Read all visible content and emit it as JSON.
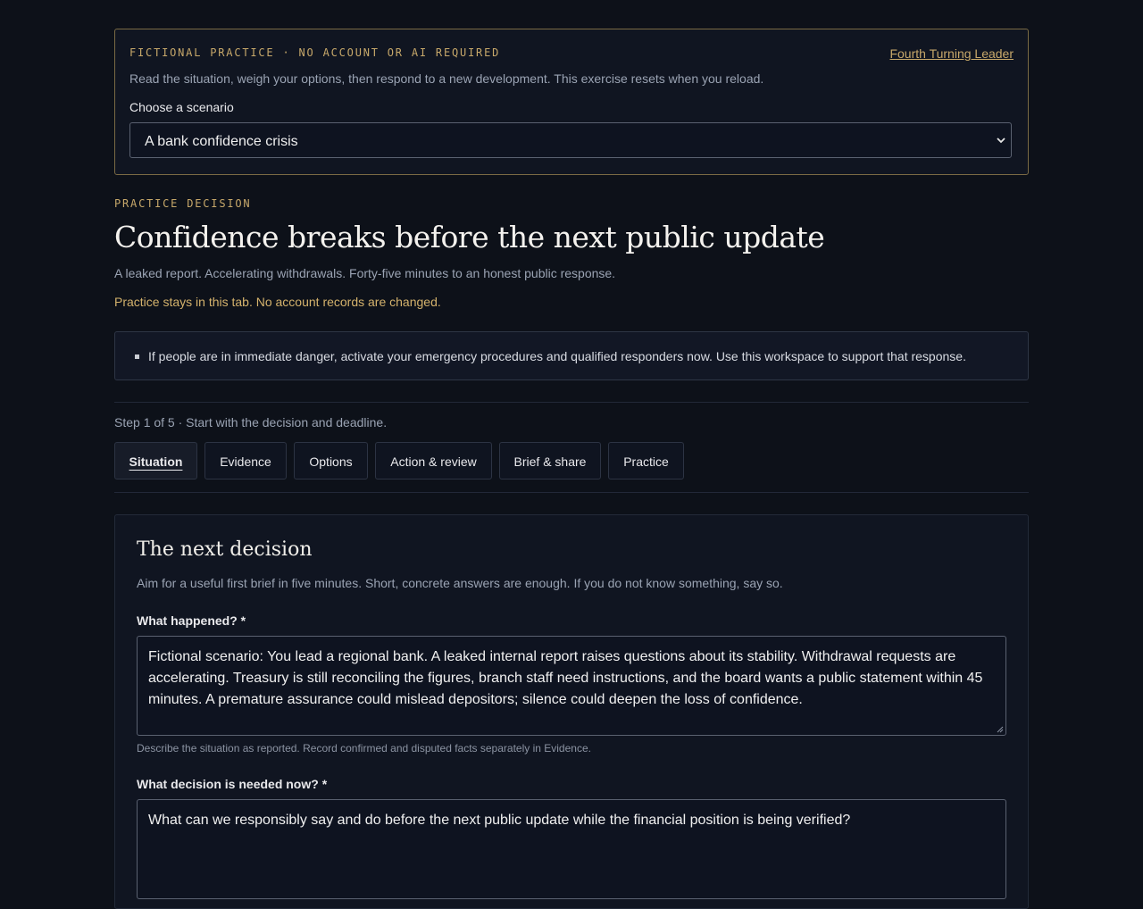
{
  "banner": {
    "tag": "FICTIONAL PRACTICE · NO ACCOUNT OR AI REQUIRED",
    "link": "Fourth Turning Leader",
    "description": "Read the situation, weigh your options, then respond to a new development. This exercise resets when you reload.",
    "select_label": "Choose a scenario",
    "select_value": "A bank confidence crisis"
  },
  "header": {
    "eyebrow": "PRACTICE DECISION",
    "title": "Confidence breaks before the next public update",
    "subtitle": "A leaked report. Accelerating withdrawals. Forty-five minutes to an honest public response.",
    "notice": "Practice stays in this tab. No account records are changed."
  },
  "alert": {
    "text": "If people are in immediate danger, activate your emergency procedures and qualified responders now. Use this workspace to support that response."
  },
  "step": "Step 1 of 5 · Start with the decision and deadline.",
  "tabs": [
    {
      "label": "Situation",
      "active": true
    },
    {
      "label": "Evidence"
    },
    {
      "label": "Options"
    },
    {
      "label": "Action & review"
    },
    {
      "label": "Brief & share"
    },
    {
      "label": "Practice"
    }
  ],
  "panel": {
    "title": "The next decision",
    "description": "Aim for a useful first brief in five minutes. Short, concrete answers are enough. If you do not know something, say so.",
    "fields": [
      {
        "label": "What happened? *",
        "value": "Fictional scenario: You lead a regional bank. A leaked internal report raises questions about its stability. Withdrawal requests are accelerating. Treasury is still reconciling the figures, branch staff need instructions, and the board wants a public statement within 45 minutes. A premature assurance could mislead depositors; silence could deepen the loss of confidence.",
        "hint": "Describe the situation as reported. Record confirmed and disputed facts separately in Evidence."
      },
      {
        "label": "What decision is needed now? *",
        "value": "What can we responsibly say and do before the next public update while the financial position is being verified?"
      }
    ]
  },
  "colors": {
    "background": "#0d1119",
    "accent_gold": "#c7a86a",
    "notice_gold": "#d4b26c",
    "muted_text": "#9aa3b3"
  }
}
